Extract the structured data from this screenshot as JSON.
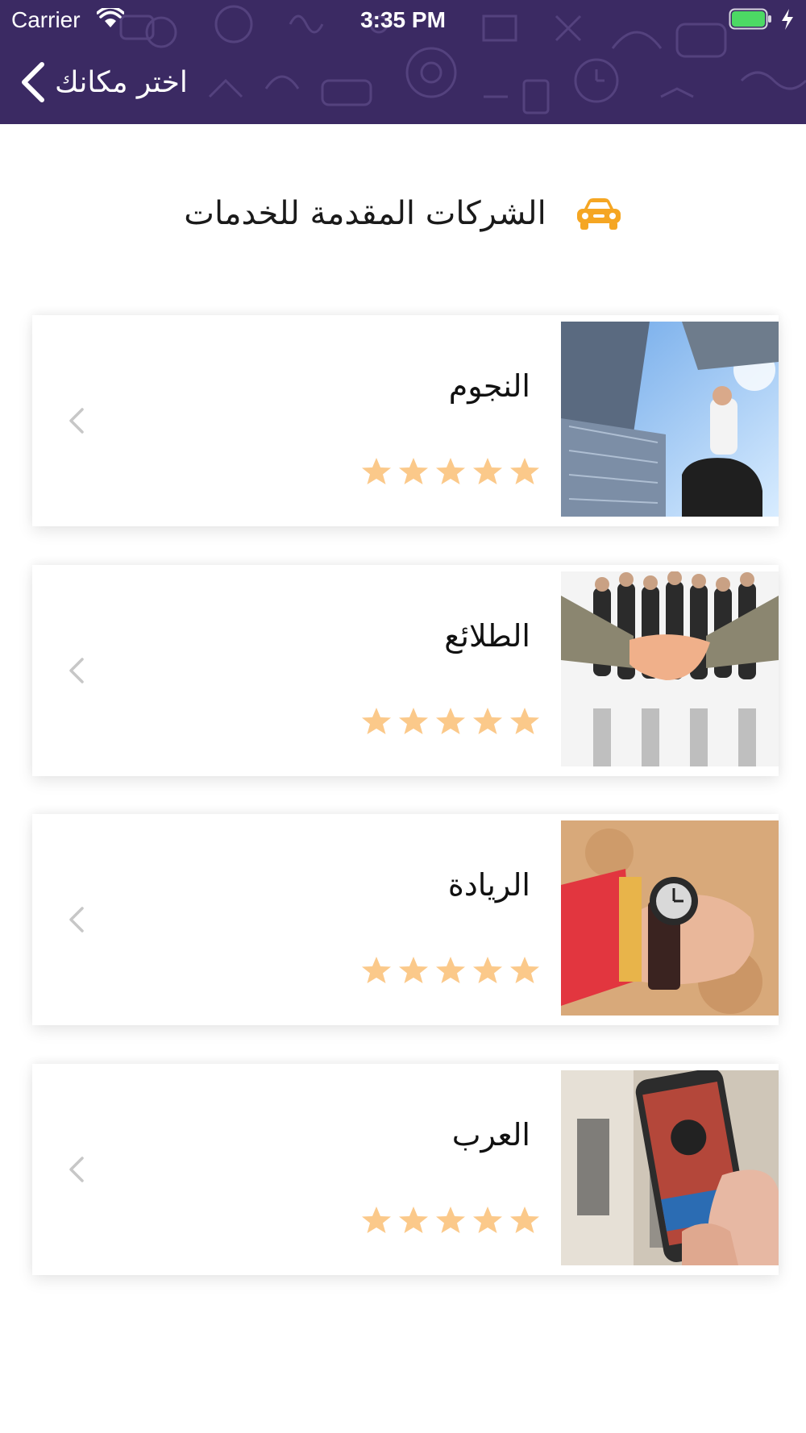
{
  "status_bar": {
    "carrier": "Carrier",
    "time": "3:35 PM",
    "battery_color": "#4cd964"
  },
  "nav": {
    "title": "اختر مكانك",
    "back_icon": "chevron-left-icon",
    "background_color": "#3b2a63"
  },
  "section": {
    "title": "الشركات المقدمة للخدمات",
    "icon": "car-icon",
    "icon_color": "#f5a623"
  },
  "companies": [
    {
      "name": "النجوم",
      "rating": 5,
      "image": "businessman-skyscrapers-photo"
    },
    {
      "name": "الطلائع",
      "rating": 5,
      "image": "handshake-team-photo"
    },
    {
      "name": "الريادة",
      "rating": 5,
      "image": "wristwatch-photo"
    },
    {
      "name": "العرب",
      "rating": 5,
      "image": "smartphone-in-hand-photo"
    }
  ],
  "colors": {
    "star": "#fbc98a",
    "chevron": "#c7c7c7"
  }
}
